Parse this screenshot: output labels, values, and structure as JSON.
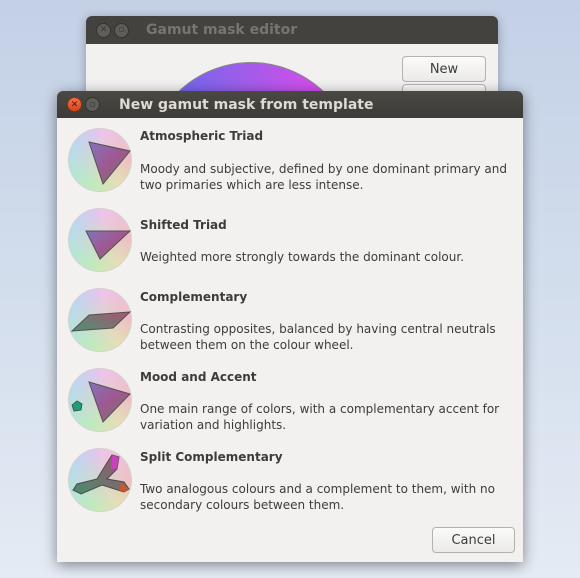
{
  "background_window": {
    "title": "Gamut mask editor",
    "new_label": "New"
  },
  "dialog": {
    "title": "New gamut mask from template",
    "cancel_label": "Cancel",
    "templates": [
      {
        "title": "Atmospheric Triad",
        "description": "Moody and subjective, defined by one dominant primary and two primaries which are less intense."
      },
      {
        "title": "Shifted Triad",
        "description": "Weighted more strongly towards the dominant colour."
      },
      {
        "title": "Complementary",
        "description": "Contrasting opposites, balanced by having central neutrals between them on the colour wheel."
      },
      {
        "title": "Mood and Accent",
        "description": "One main range of colors, with a complementary accent for variation and highlights."
      },
      {
        "title": "Split Complementary",
        "description": "Two analogous colours and a complement to them, with no secondary colours between them."
      }
    ]
  },
  "colors": {
    "titlebar": "#3c3b37",
    "close_button": "#e05a2c",
    "dialog_bg": "#f2f1f0"
  }
}
